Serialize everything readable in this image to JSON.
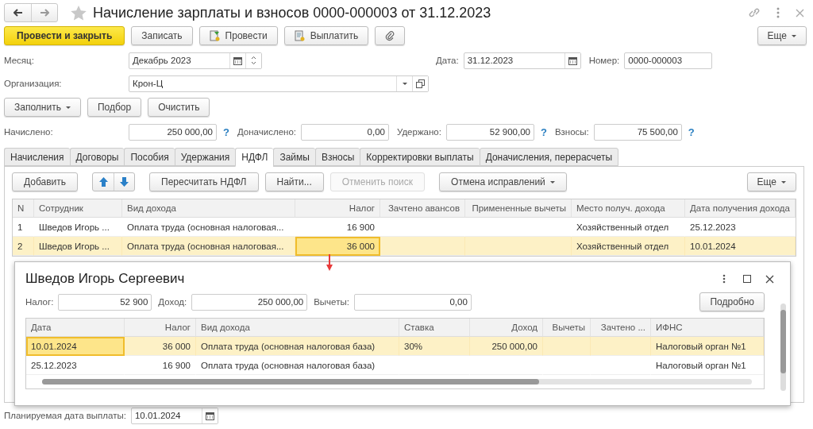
{
  "window": {
    "title": "Начисление зарплаты и взносов 0000-000003 от 31.12.2023",
    "favorite": false
  },
  "command_bar": {
    "buttons": [
      {
        "kind": "primary",
        "label": "Провести и закрыть"
      },
      {
        "kind": "plain",
        "label": "Записать"
      },
      {
        "kind": "post",
        "label": "Провести"
      },
      {
        "kind": "pay",
        "label": "Выплатить"
      },
      {
        "kind": "attach"
      }
    ],
    "more": "Еще"
  },
  "header": {
    "month_label": "Месяц:",
    "month": "Декабрь 2023",
    "date_label": "Дата:",
    "date": "31.12.2023",
    "number_label": "Номер:",
    "number": "0000-000003",
    "org_label": "Организация:",
    "org": "Крон-Ц"
  },
  "fill_buttons": [
    {
      "label": "Заполнить",
      "dropdown": true
    },
    {
      "label": "Подбор",
      "dropdown": false
    },
    {
      "label": "Очистить",
      "dropdown": false
    }
  ],
  "totals": [
    {
      "label": "Начислено:",
      "value": "250 000,00",
      "help": "?"
    },
    {
      "label": "Доначислено:",
      "value": "0,00"
    },
    {
      "label": "Удержано:",
      "value": "52 900,00",
      "help": "?"
    },
    {
      "label": "Взносы:",
      "value": "75 500,00",
      "help": "?"
    }
  ],
  "tabs": [
    {
      "label": "Начисления",
      "selected": false
    },
    {
      "label": "Договоры",
      "selected": false
    },
    {
      "label": "Пособия",
      "selected": false
    },
    {
      "label": "Удержания",
      "selected": false
    },
    {
      "label": "НДФЛ",
      "selected": true
    },
    {
      "label": "Займы",
      "selected": false
    },
    {
      "label": "Взносы",
      "selected": false
    },
    {
      "label": "Корректировки выплаты",
      "selected": false
    },
    {
      "label": "Доначисления, перерасчеты",
      "selected": false
    }
  ],
  "table_toolbar": {
    "buttons": [
      {
        "kind": "text",
        "label": "Добавить",
        "disabled": false,
        "dropdown": false
      },
      {
        "kind": "arrows"
      },
      {
        "kind": "text",
        "label": "Пересчитать НДФЛ",
        "disabled": false,
        "dropdown": false
      },
      {
        "kind": "text",
        "label": "Найти...",
        "disabled": false,
        "dropdown": false
      },
      {
        "kind": "text",
        "label": "Отменить поиск",
        "disabled": true,
        "dropdown": false
      },
      {
        "kind": "text",
        "label": "Отмена исправлений",
        "disabled": false,
        "dropdown": true
      }
    ],
    "more": "Еще"
  },
  "table": {
    "columns": [
      {
        "title": "N",
        "numeric": false
      },
      {
        "title": "Сотрудник",
        "numeric": false
      },
      {
        "title": "Вид дохода",
        "numeric": false
      },
      {
        "title": "Налог",
        "numeric": true
      },
      {
        "title": "Зачтено авансов",
        "numeric": true
      },
      {
        "title": "Примененные вычеты",
        "numeric": true
      },
      {
        "title": "Место получ. дохода",
        "numeric": false
      },
      {
        "title": "Дата получения дохода",
        "numeric": false
      }
    ],
    "rows": [
      {
        "selected": false,
        "cells": [
          {
            "text": "1",
            "focused": false
          },
          {
            "text": "Шведов Игорь ...",
            "focused": false
          },
          {
            "text": "Оплата труда (основная налоговая...",
            "focused": false
          },
          {
            "text": "16 900",
            "focused": false
          },
          {
            "focused": false
          },
          {
            "focused": false
          },
          {
            "text": "Хозяйственный отдел",
            "focused": false
          },
          {
            "text": "25.12.2023",
            "focused": false
          }
        ]
      },
      {
        "selected": true,
        "cells": [
          {
            "text": "2",
            "focused": false
          },
          {
            "text": "Шведов Игорь ...",
            "focused": false
          },
          {
            "text": "Оплата труда (основная налоговая...",
            "focused": false
          },
          {
            "text": "36 000",
            "focused": true
          },
          {
            "focused": false
          },
          {
            "focused": false
          },
          {
            "text": "Хозяйственный отдел",
            "focused": false
          },
          {
            "text": "10.01.2024",
            "focused": false
          }
        ]
      }
    ]
  },
  "popup": {
    "title": "Шведов Игорь Сергеевич",
    "fields": [
      {
        "label": "Налог:",
        "value": "52 900"
      },
      {
        "label": "Доход:",
        "value": "250 000,00"
      },
      {
        "label": "Вычеты:",
        "value": "0,00"
      }
    ],
    "details_button": "Подробно",
    "table": {
      "columns": [
        {
          "title": "Дата",
          "numeric": false
        },
        {
          "title": "Налог",
          "numeric": true
        },
        {
          "title": "Вид дохода",
          "numeric": false
        },
        {
          "title": "Ставка",
          "numeric": false
        },
        {
          "title": "Доход",
          "numeric": true
        },
        {
          "title": "Вычеты",
          "numeric": true
        },
        {
          "title": "Зачтено ...",
          "numeric": true
        },
        {
          "title": "ИФНС",
          "numeric": false
        }
      ],
      "rows": [
        {
          "selected": true,
          "cells": [
            {
              "text": "10.01.2024",
              "focused": true
            },
            {
              "text": "36 000",
              "focused": false
            },
            {
              "text": "Оплата труда (основная налоговая база)",
              "focused": false
            },
            {
              "text": "30%",
              "focused": false
            },
            {
              "text": "250 000,00",
              "focused": false
            },
            {
              "focused": false
            },
            {
              "focused": false
            },
            {
              "text": "Налоговый орган №1",
              "focused": false
            }
          ]
        },
        {
          "selected": false,
          "cells": [
            {
              "text": "25.12.2023",
              "focused": false
            },
            {
              "text": "16 900",
              "focused": false
            },
            {
              "text": "Оплата труда (основная налоговая база)",
              "focused": false
            },
            {
              "focused": false
            },
            {
              "focused": false
            },
            {
              "focused": false
            },
            {
              "focused": false
            },
            {
              "text": "Налоговый орган №1",
              "focused": false
            }
          ]
        }
      ]
    }
  },
  "footer": {
    "label": "Планируемая дата выплаты:",
    "date": "10.01.2024"
  }
}
